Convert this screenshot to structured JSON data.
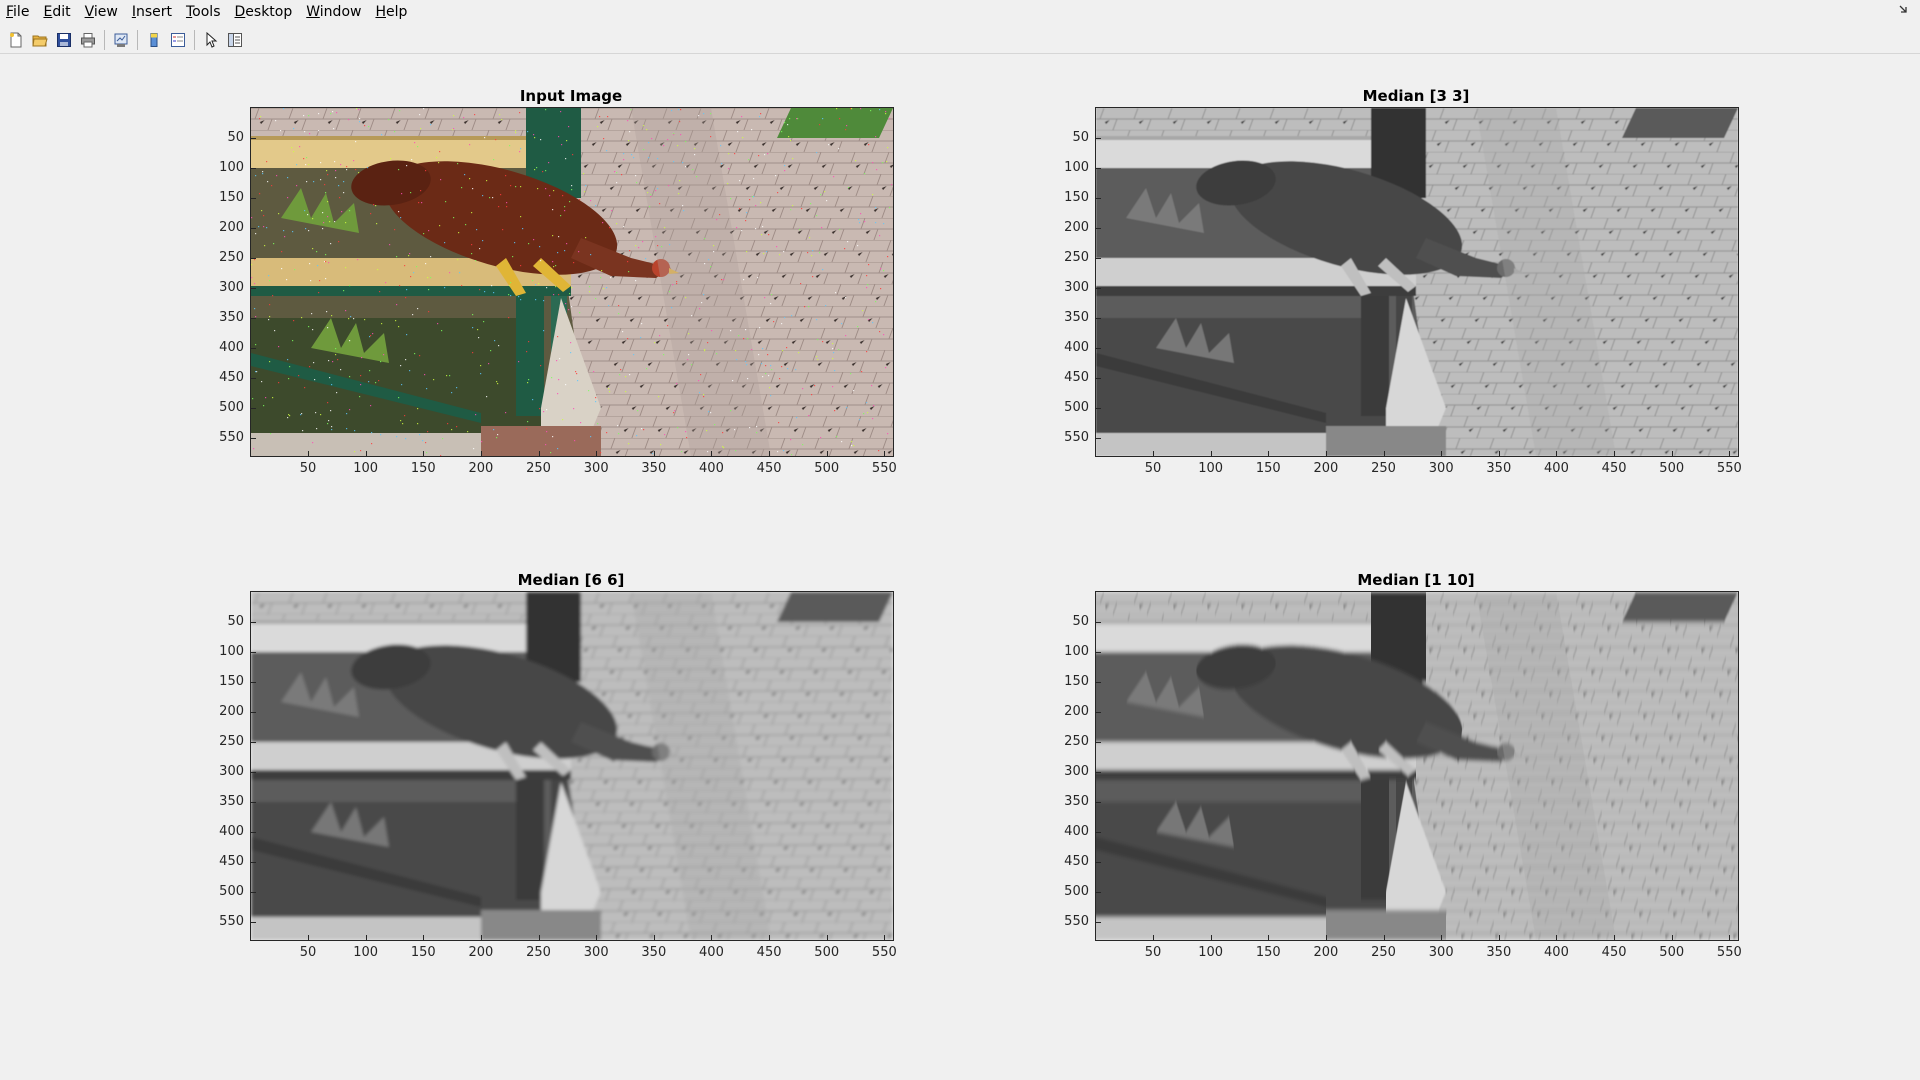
{
  "menu": {
    "items": [
      {
        "key": "F",
        "rest": "ile"
      },
      {
        "key": "E",
        "rest": "dit"
      },
      {
        "key": "V",
        "rest": "iew"
      },
      {
        "key": "I",
        "rest": "nsert"
      },
      {
        "key": "T",
        "rest": "ools"
      },
      {
        "key": "D",
        "rest": "esktop"
      },
      {
        "key": "W",
        "rest": "indow"
      },
      {
        "key": "H",
        "rest": "elp"
      }
    ],
    "dock_icon": "dock-arrow-icon"
  },
  "toolbar": {
    "buttons": [
      "new-figure-icon",
      "open-file-icon",
      "save-icon",
      "print-icon",
      "link-plot-icon",
      "colorbar-icon",
      "legend-icon",
      "edit-plot-icon",
      "property-inspector-icon"
    ]
  },
  "axes": [
    {
      "title": "Input Image",
      "mode": "color"
    },
    {
      "title": "Median [3 3]",
      "mode": "gray"
    },
    {
      "title": "Median [6 6]",
      "mode": "gray-blur"
    },
    {
      "title": "Median [1 10]",
      "mode": "gray-streak"
    }
  ],
  "ticks": {
    "y": [
      "50",
      "100",
      "150",
      "200",
      "250",
      "300",
      "350",
      "400",
      "450",
      "500",
      "550"
    ],
    "x": [
      "50",
      "100",
      "150",
      "200",
      "250",
      "300",
      "350",
      "400",
      "450",
      "500",
      "550"
    ]
  }
}
